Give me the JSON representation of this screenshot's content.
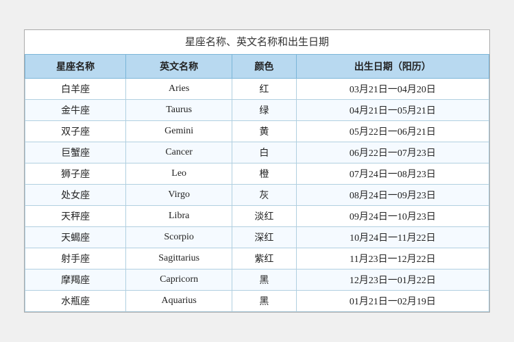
{
  "title": "星座名称、英文名称和出生日期",
  "headers": [
    "星座名称",
    "英文名称",
    "颜色",
    "出生日期（阳历）"
  ],
  "rows": [
    {
      "chinese": "白羊座",
      "english": "Aries",
      "color": "红",
      "dates": "03月21日一04月20日"
    },
    {
      "chinese": "金牛座",
      "english": "Taurus",
      "color": "绿",
      "dates": "04月21日一05月21日"
    },
    {
      "chinese": "双子座",
      "english": "Gemini",
      "color": "黄",
      "dates": "05月22日一06月21日"
    },
    {
      "chinese": "巨蟹座",
      "english": "Cancer",
      "color": "白",
      "dates": "06月22日一07月23日"
    },
    {
      "chinese": "狮子座",
      "english": "Leo",
      "color": "橙",
      "dates": "07月24日一08月23日"
    },
    {
      "chinese": "处女座",
      "english": "Virgo",
      "color": "灰",
      "dates": "08月24日一09月23日"
    },
    {
      "chinese": "天秤座",
      "english": "Libra",
      "color": "淡红",
      "dates": "09月24日一10月23日"
    },
    {
      "chinese": "天蝎座",
      "english": "Scorpio",
      "color": "深红",
      "dates": "10月24日一11月22日"
    },
    {
      "chinese": "射手座",
      "english": "Sagittarius",
      "color": "紫红",
      "dates": "11月23日一12月22日"
    },
    {
      "chinese": "摩羯座",
      "english": "Capricorn",
      "color": "黑",
      "dates": "12月23日一01月22日"
    },
    {
      "chinese": "水瓶座",
      "english": "Aquarius",
      "color": "黑",
      "dates": "01月21日一02月19日"
    }
  ]
}
